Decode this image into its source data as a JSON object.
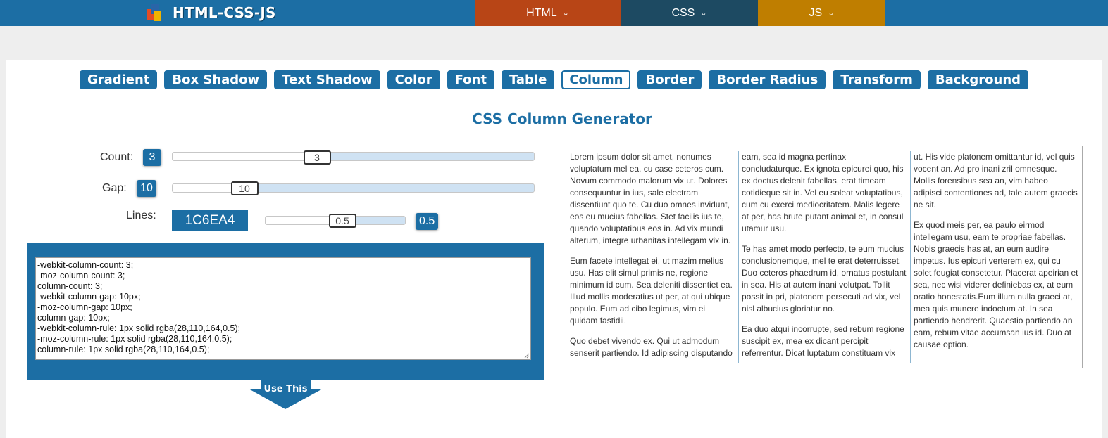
{
  "site": {
    "brand": "HTML-CSS-JS",
    "nav": [
      {
        "label": "HTML",
        "color": "#b84516"
      },
      {
        "label": "CSS",
        "color": "#1d4a62"
      },
      {
        "label": "JS",
        "color": "#bf7e00"
      }
    ]
  },
  "tools": [
    "Gradient",
    "Box Shadow",
    "Text Shadow",
    "Color",
    "Font",
    "Table",
    "Column",
    "Border",
    "Border Radius",
    "Transform",
    "Background"
  ],
  "active_tool": "Column",
  "title": "CSS Column Generator",
  "controls": {
    "count": {
      "label": "Count:",
      "value": "3",
      "fraction": 0.4
    },
    "gap": {
      "label": "Gap:",
      "value": "10",
      "fraction": 0.2
    },
    "lines": {
      "label": "Lines:",
      "color": "1C6EA4",
      "opacity": "0.5",
      "fraction": 0.55
    }
  },
  "code": [
    "-webkit-column-count: 3;",
    "-moz-column-count: 3;",
    "column-count: 3;",
    "-webkit-column-gap: 10px;",
    "-moz-column-gap: 10px;",
    "column-gap: 10px;",
    "-webkit-column-rule: 1px solid rgba(28,110,164,0.5);",
    "-moz-column-rule: 1px solid rgba(28,110,164,0.5);",
    "column-rule: 1px solid rgba(28,110,164,0.5);"
  ],
  "use_button": "Use This",
  "preview_paragraphs": [
    "Lorem ipsum dolor sit amet, nonumes voluptatum mel ea, cu case ceteros cum. Novum commodo malorum vix ut. Dolores consequuntur in ius, sale electram dissentiunt quo te. Cu duo omnes invidunt, eos eu mucius fabellas. Stet facilis ius te, quando voluptatibus eos in. Ad vix mundi alterum, integre urbanitas intellegam vix in.",
    "Eum facete intellegat ei, ut mazim melius usu. Has elit simul primis ne, regione minimum id cum. Sea deleniti dissentiet ea. Illud mollis moderatius ut per, at qui ubique populo. Eum ad cibo legimus, vim ei quidam fastidii.",
    "Quo debet vivendo ex. Qui ut admodum senserit partiendo. Id adipiscing disputando eam, sea id magna pertinax concludaturque. Ex ignota epicurei quo, his ex doctus delenit fabellas, erat timeam cotidieque sit in. Vel eu soleat voluptatibus, cum cu exerci mediocritatem. Malis legere at per, has brute putant animal et, in consul utamur usu.",
    "Te has amet modo perfecto, te eum mucius conclusionemque, mel te erat deterruisset. Duo ceteros phaedrum id, ornatus postulant in sea. His at autem inani volutpat. Tollit possit in pri, platonem persecuti ad vix, vel nisl albucius gloriatur no.",
    "Ea duo atqui incorrupte, sed rebum regione suscipit ex, mea ex dicant percipit referrentur. Dicat luptatum constituam vix ut. His vide platonem omittantur id, vel quis vocent an. Ad pro inani zril omnesque. Mollis forensibus sea an, vim habeo adipisci contentiones ad, tale autem graecis ne sit.",
    "Ex quod meis per, ea paulo eirmod intellegam usu, eam te propriae fabellas. Nobis graecis has at, an eum audire impetus. Ius epicuri verterem ex, qui cu solet feugiat consetetur. Placerat apeirian et sea, nec wisi viderer definiebas ex, at eum oratio honestatis.Eum illum nulla graeci at, mea quis munere indoctum at. In sea partiendo hendrerit. Quaestio partiendo an eam, rebum vitae accumsan ius id. Duo at causae option."
  ]
}
